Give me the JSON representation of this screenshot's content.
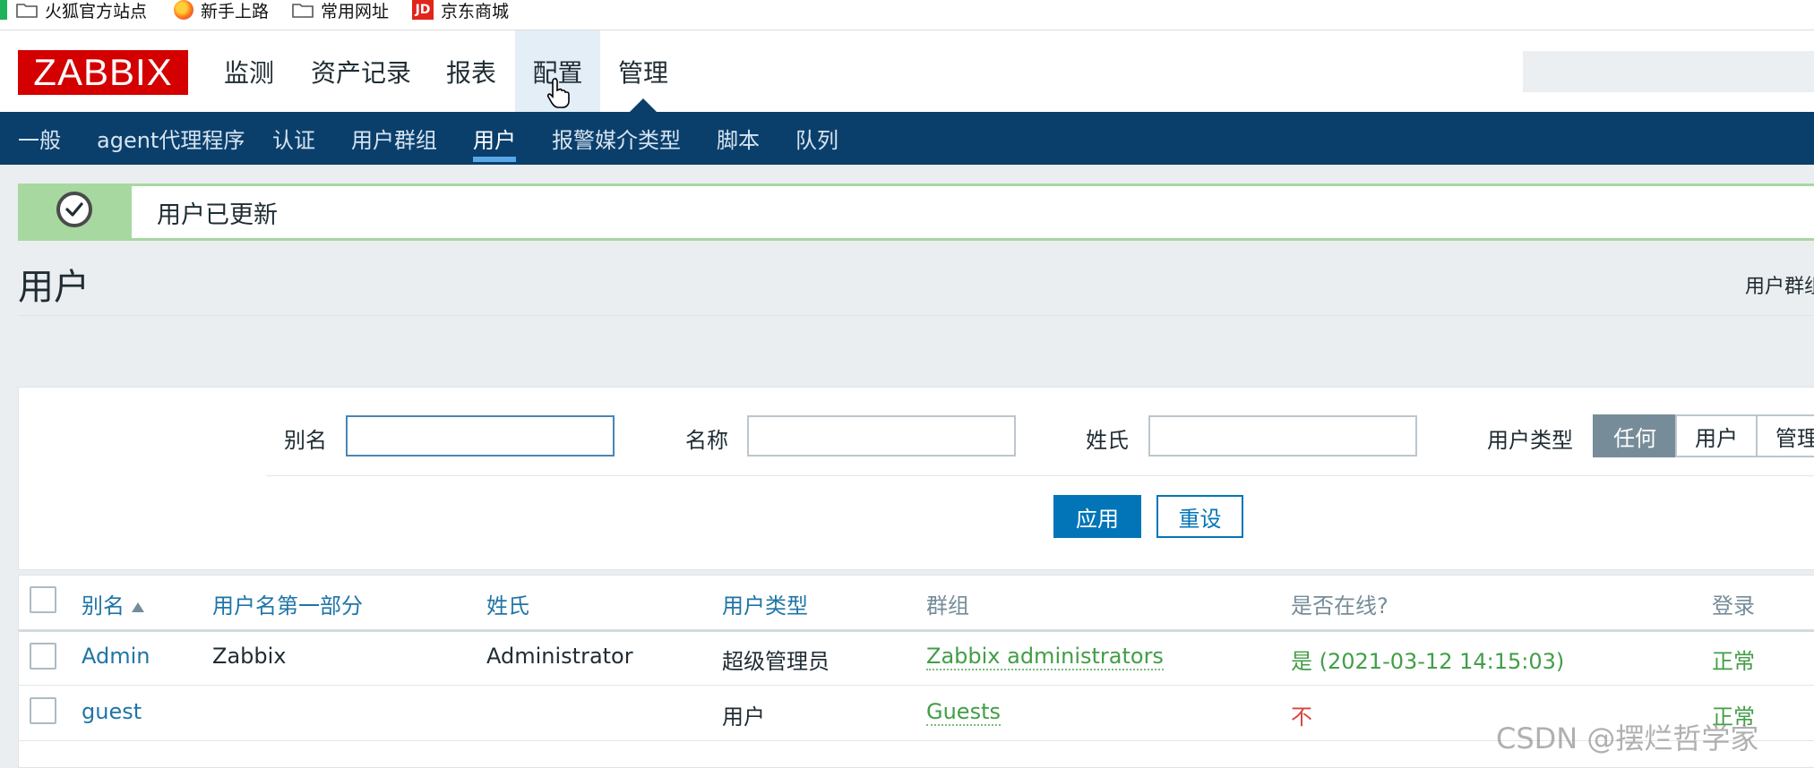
{
  "bookmarks": [
    {
      "label": "火狐官方站点",
      "icon": "folder-icon"
    },
    {
      "label": "新手上路",
      "icon": "firefox-icon"
    },
    {
      "label": "常用网址",
      "icon": "folder-icon"
    },
    {
      "label": "京东商城",
      "icon": "jd-icon",
      "icon_text": "JD"
    }
  ],
  "logo": "ZABBIX",
  "top_nav": [
    {
      "label": "监测"
    },
    {
      "label": "资产记录"
    },
    {
      "label": "报表"
    },
    {
      "label": "配置",
      "hovered": true
    },
    {
      "label": "管理",
      "active": true
    }
  ],
  "sub_nav": [
    {
      "label": "一般"
    },
    {
      "label": "agent代理程序"
    },
    {
      "label": "认证"
    },
    {
      "label": "用户群组"
    },
    {
      "label": "用户",
      "active": true
    },
    {
      "label": "报警媒介类型"
    },
    {
      "label": "脚本"
    },
    {
      "label": "队列"
    }
  ],
  "message": {
    "text": "用户已更新",
    "type": "success"
  },
  "page": {
    "title": "用户",
    "right_label": "用户群组"
  },
  "filter": {
    "alias_label": "别名",
    "alias_value": "",
    "name_label": "名称",
    "name_value": "",
    "surname_label": "姓氏",
    "surname_value": "",
    "user_type_label": "用户类型",
    "user_type_options": [
      "任何",
      "用户",
      "管理员"
    ],
    "user_type_selected": "任何",
    "apply_label": "应用",
    "reset_label": "重设"
  },
  "table": {
    "columns": [
      "别名",
      "用户名第一部分",
      "姓氏",
      "用户类型",
      "群组",
      "是否在线?",
      "登录"
    ],
    "sorted_column": "别名",
    "sort_direction": "asc",
    "rows": [
      {
        "alias": "Admin",
        "name": "Zabbix",
        "surname": "Administrator",
        "type": "超级管理员",
        "group": "Zabbix administrators",
        "online": "是 (2021-03-12 14:15:03)",
        "login": "正常"
      },
      {
        "alias": "guest",
        "name": "",
        "surname": "",
        "type": "用户",
        "group": "Guests",
        "online": "不",
        "login": "正常"
      }
    ]
  },
  "watermark": "CSDN @摆烂哲学家",
  "colors": {
    "brand": "#d40000",
    "subnav_bg": "#0b3f6b",
    "link": "#1f75a6",
    "success": "#429e47",
    "danger": "#d64541",
    "primary_button": "#0275b8"
  }
}
